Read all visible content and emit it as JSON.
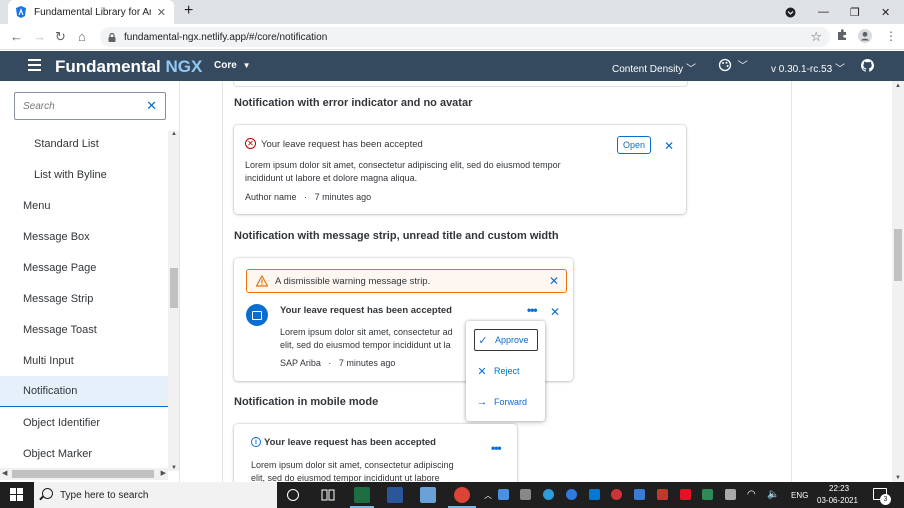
{
  "browser": {
    "tab_title": "Fundamental Library for Angular",
    "url": "fundamental-ngx.netlify.app/#/core/notification"
  },
  "shellbar": {
    "brand": "Fundamental",
    "brand_accent": "NGX",
    "product": "Core",
    "content_density": "Content Density",
    "version": "v 0.30.1-rc.53"
  },
  "sidebar": {
    "search_placeholder": "Search",
    "items": [
      {
        "label": "Standard List",
        "indent": true
      },
      {
        "label": "List with Byline",
        "indent": true
      },
      {
        "label": "Menu"
      },
      {
        "label": "Message Box"
      },
      {
        "label": "Message Page"
      },
      {
        "label": "Message Strip"
      },
      {
        "label": "Message Toast"
      },
      {
        "label": "Multi Input"
      },
      {
        "label": "Notification",
        "active": true
      },
      {
        "label": "Object Identifier"
      },
      {
        "label": "Object Marker"
      }
    ]
  },
  "sections": {
    "error_title": "Notification with error indicator and no avatar",
    "strip_title": "Notification with message strip, unread title and custom width",
    "mobile_title": "Notification in mobile mode"
  },
  "notifications": {
    "error": {
      "title": "Your leave request has been accepted",
      "body_line1": "Lorem ipsum dolor sit amet, consectetur adipiscing elit, sed do eiusmod tempor",
      "body_line2": "incididunt ut labore et dolore magna aliqua.",
      "author": "Author name",
      "sep": "·",
      "time": "7 minutes ago",
      "open_label": "Open"
    },
    "strip": {
      "strip_text": "A dismissible warning message strip.",
      "title": "Your leave request has been accepted",
      "body_line1": "Lorem ipsum dolor sit amet, consectetur ad",
      "body_line2": "elit, sed do eiusmod tempor incididunt ut la",
      "author": "SAP Ariba",
      "sep": "·",
      "time": "7 minutes ago",
      "menu": [
        "Approve",
        "Reject",
        "Forward"
      ]
    },
    "mobile": {
      "title": "Your leave request has been accepted",
      "body_line1": "Lorem ipsum dolor sit amet, consectetur adipiscing",
      "body_line2": "elit, sed do eiusmod tempor incididunt ut labore"
    }
  },
  "taskbar": {
    "search_placeholder": "Type here to search",
    "language": "ENG",
    "time": "22:23",
    "date": "03-06-2021",
    "notification_count": "3"
  },
  "colors": {
    "shell": "#354a5f",
    "accent": "#0a6ed1",
    "error": "#bb0000",
    "warning": "#e9730c"
  }
}
